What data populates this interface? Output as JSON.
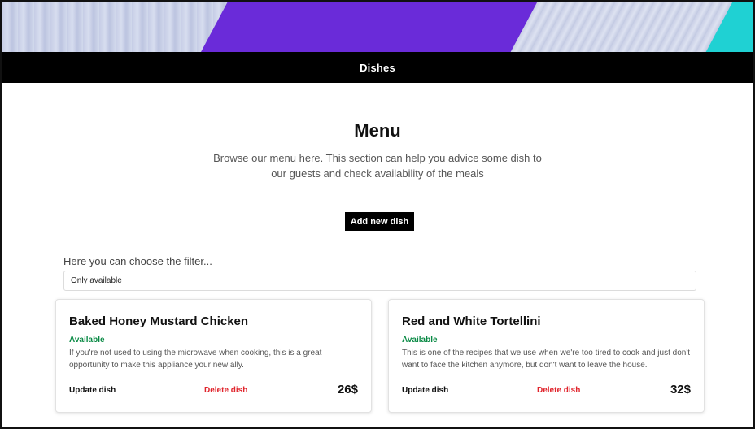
{
  "nav": {
    "title": "Dishes"
  },
  "menu": {
    "heading": "Menu",
    "subtitle": "Browse our menu here. This section can help you advice some dish to our guests and check availability of the meals",
    "add_button": "Add new dish"
  },
  "filter": {
    "label": "Here you can choose the filter...",
    "selected": "Only available"
  },
  "dishes": [
    {
      "name": "Baked Honey Mustard Chicken",
      "status": "Available",
      "description": "If you're not used to using the microwave when cooking, this is a great opportunity to make this appliance your new ally.",
      "update_label": "Update dish",
      "delete_label": "Delete dish",
      "price": "26$"
    },
    {
      "name": "Red and White Tortellini",
      "status": "Available",
      "description": "This is one of the recipes that we use when we're too tired to cook and just don't want to face the kitchen anymore, but don't want to leave the house.",
      "update_label": "Update dish",
      "delete_label": "Delete dish",
      "price": "32$"
    }
  ],
  "colors": {
    "hero_purple": "#6a2bd9",
    "hero_teal": "#1fd1d3",
    "available_green": "#0a8a45",
    "delete_red": "#e0242c",
    "navbar_bg": "#000000"
  }
}
